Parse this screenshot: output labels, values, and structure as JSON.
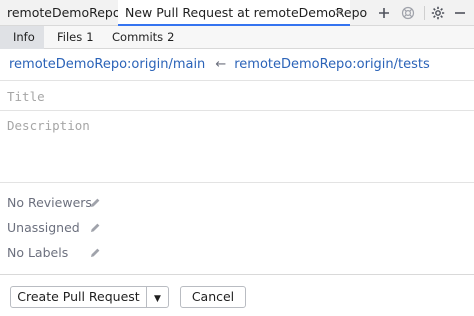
{
  "tabs": {
    "repo_tab": "remoteDemoRepo",
    "pr_tab": "New Pull Request at remoteDemoRepo",
    "toolbar_icons": [
      "plus-icon",
      "lifebuoy-icon",
      "gear-icon",
      "minimize-icon"
    ]
  },
  "subtabs": [
    {
      "label": "Info",
      "count": ""
    },
    {
      "label": "Files",
      "count": "1"
    },
    {
      "label": "Commits",
      "count": "2"
    }
  ],
  "branches": {
    "base": "remoteDemoRepo:origin/main",
    "arrow": "←",
    "head": "remoteDemoRepo:origin/tests"
  },
  "form": {
    "title_placeholder": "Title",
    "title_value": "",
    "description_placeholder": "Description",
    "description_value": ""
  },
  "meta": {
    "reviewers": "No Reviewers",
    "assignees": "Unassigned",
    "labels": "No Labels"
  },
  "footer": {
    "create_label": "Create Pull Request",
    "dropdown_glyph": "▼",
    "cancel_label": "Cancel"
  },
  "colors": {
    "accent": "#3574f0",
    "link": "#2b63b8",
    "muted": "#6c707e"
  }
}
